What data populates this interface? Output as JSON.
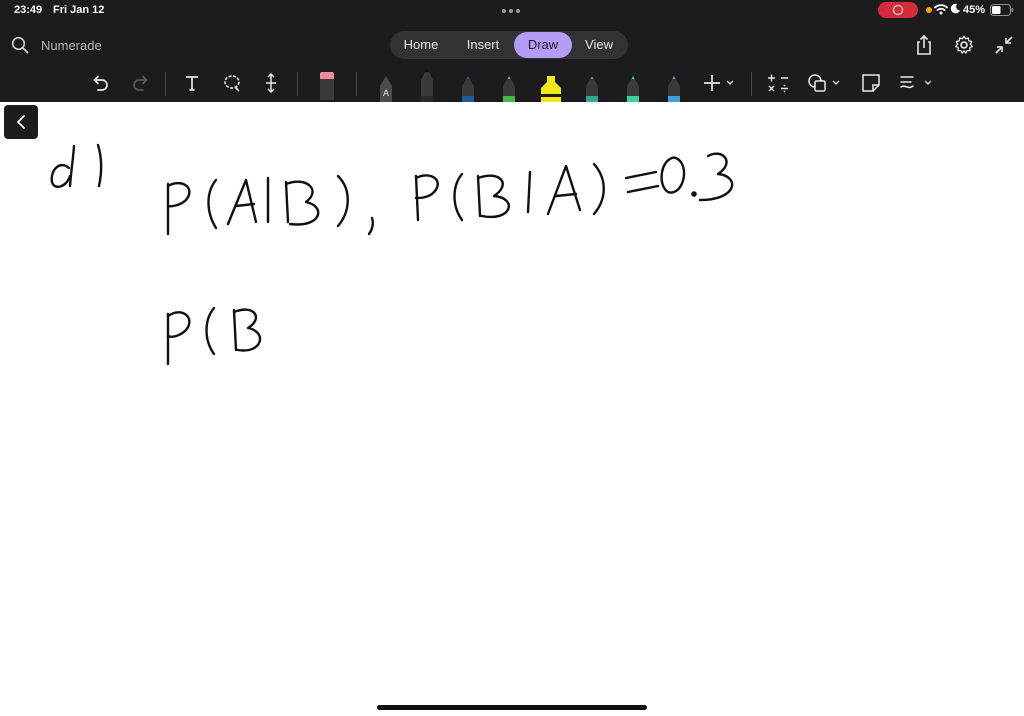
{
  "status_bar": {
    "time": "23:49",
    "date": "Fri Jan 12",
    "battery": "45%"
  },
  "app": {
    "search_label": "Numerade"
  },
  "tabs": [
    {
      "label": "Home",
      "active": false
    },
    {
      "label": "Insert",
      "active": false
    },
    {
      "label": "Draw",
      "active": true
    },
    {
      "label": "View",
      "active": false
    }
  ],
  "right_icons": [
    "share-icon",
    "settings-gear-icon",
    "collapse-arrows-icon"
  ],
  "toolbar": {
    "tools": [
      "undo-icon",
      "redo-icon",
      "text-tool-icon",
      "lasso-select-icon",
      "insert-space-icon",
      "eraser-icon"
    ],
    "pens": [
      {
        "name": "pen-with-label",
        "label": "A",
        "color": "#4a4a4e"
      },
      {
        "name": "pencil-black",
        "color": "#2a2a2c"
      },
      {
        "name": "pen-blue",
        "color": "#1e5a9c"
      },
      {
        "name": "pen-green",
        "color": "#4cb34a"
      },
      {
        "name": "highlighter-yellow",
        "color": "#f2e81e"
      },
      {
        "name": "pen-teal",
        "color": "#2fa88c"
      },
      {
        "name": "pen-mint",
        "color": "#3fcfa0"
      },
      {
        "name": "pen-cyan",
        "color": "#3aa4d6"
      }
    ],
    "extra_tools": [
      "add-pen-icon",
      "math-icon",
      "shapes-icon",
      "sticky-note-icon",
      "ink-to-text-icon"
    ]
  },
  "colors": {
    "toolbar_bg": "#1c1c1e",
    "active_tab": "#b59cf4",
    "record": "#d62b3a",
    "ink": "#111111"
  }
}
